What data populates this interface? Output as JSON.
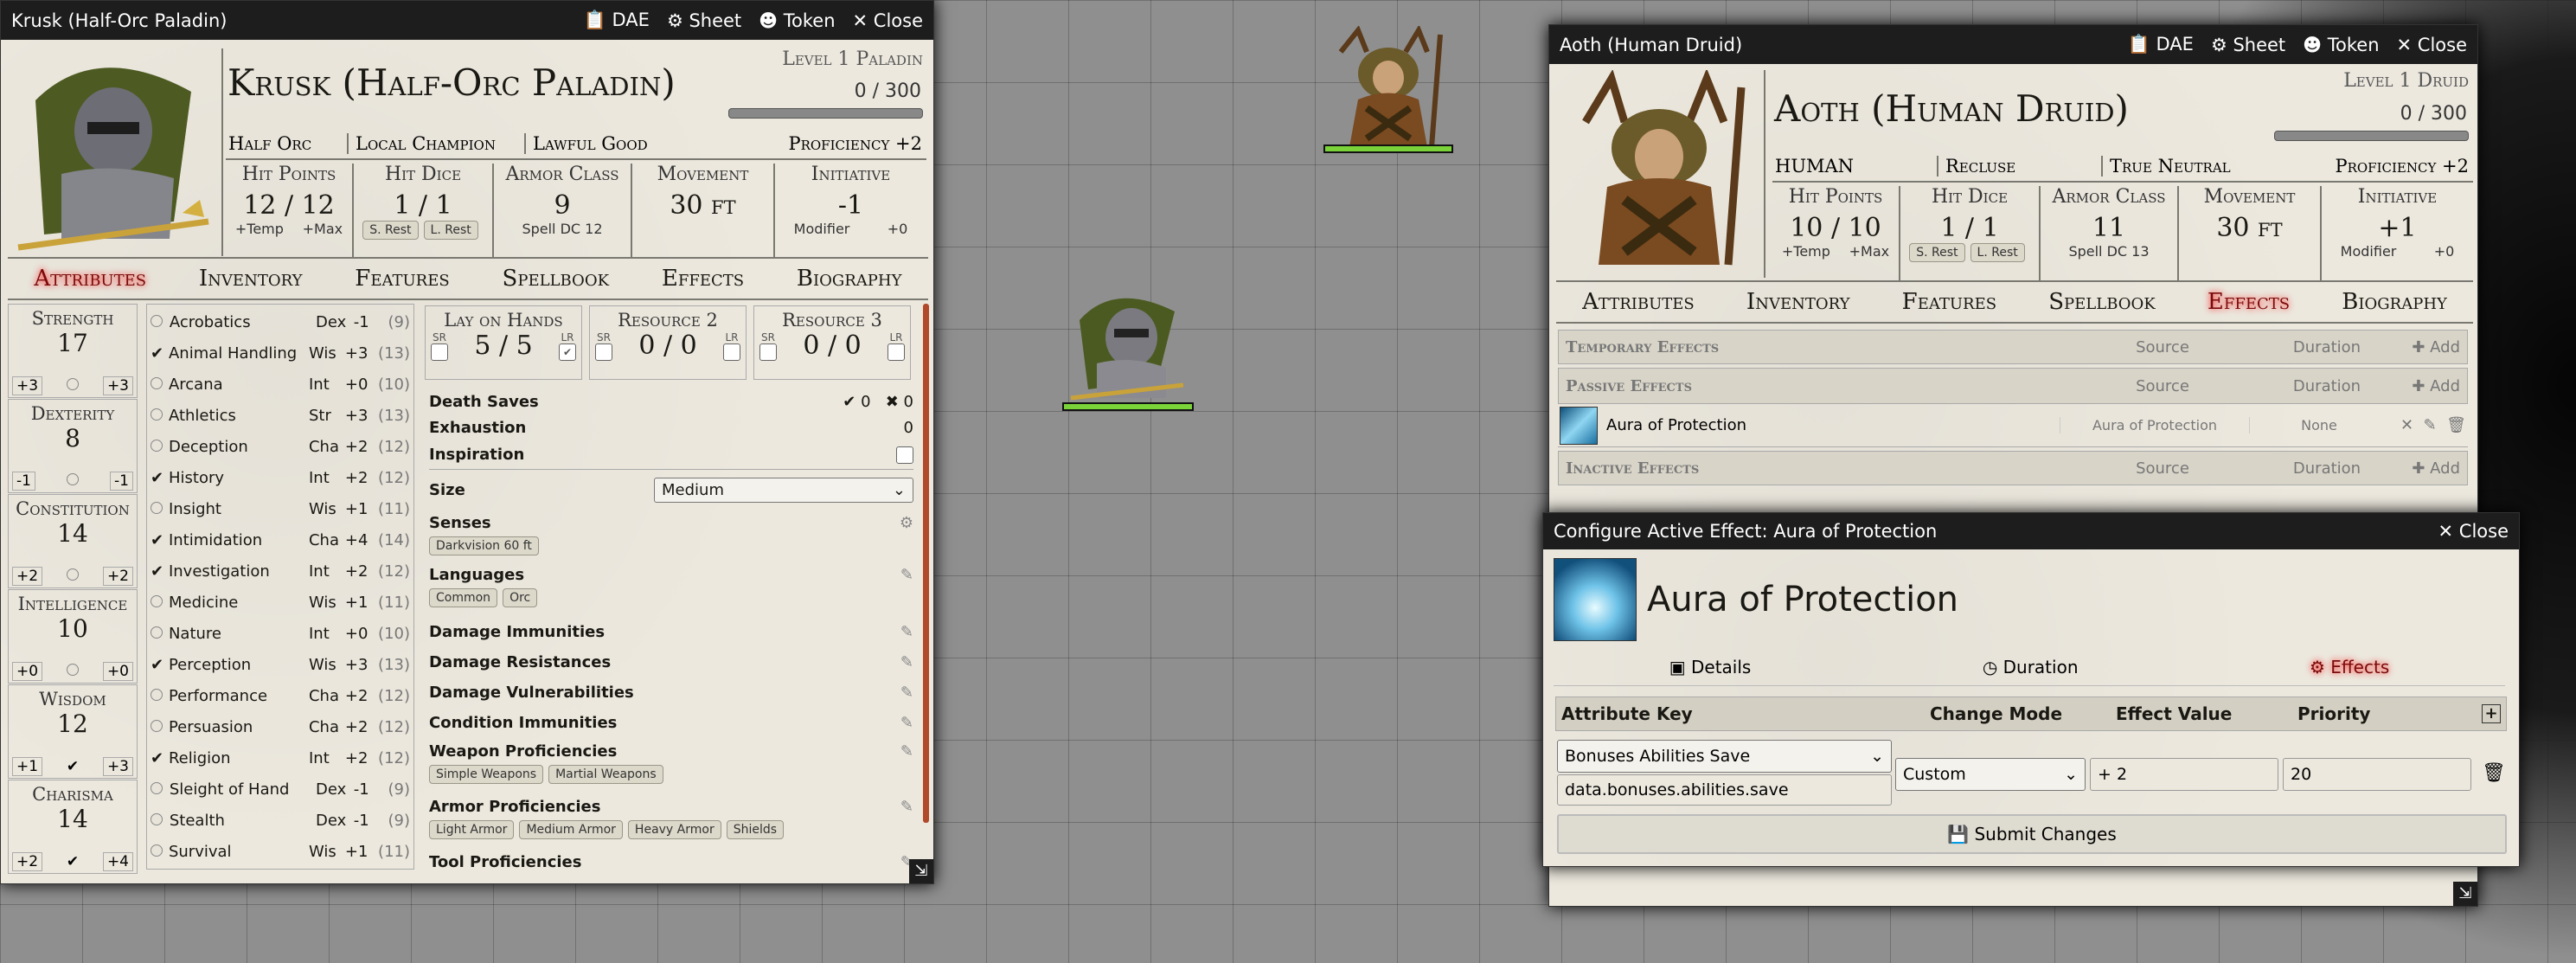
{
  "colors": {
    "hp_bar": "#7bd33a",
    "accent": "#7a0a0a",
    "scrollbar": "#b14a2a",
    "titlebar": "#1d1d1d"
  },
  "tokens": [
    {
      "name": "druid-token"
    },
    {
      "name": "paladin-token"
    }
  ],
  "left": {
    "title": "Krusk (Half-Orc Paladin)",
    "header_buttons": {
      "dae": "DAE",
      "sheet": "Sheet",
      "token": "Token",
      "close": "Close"
    },
    "name": "Krusk (Half-Orc Paladin)",
    "level": "Level 1 Paladin",
    "xp": "0 / 300",
    "race": "Half Orc",
    "background": "Local Champion",
    "alignment": "Lawful Good",
    "proficiency": "Proficiency +2",
    "hp": {
      "label": "Hit Points",
      "value": "12",
      "max": "12",
      "temp": "+Temp",
      "maxlbl": "+Max"
    },
    "hd": {
      "label": "Hit Dice",
      "value": "1 / 1",
      "short": "S. Rest",
      "long": "L. Rest"
    },
    "ac": {
      "label": "Armor Class",
      "value": "9",
      "sub": "Spell DC 12"
    },
    "move": {
      "label": "Movement",
      "value": "30 ft"
    },
    "init": {
      "label": "Initiative",
      "value": "-1",
      "mod": "Modifier",
      "bonus": "+0"
    },
    "tabs": [
      "Attributes",
      "Inventory",
      "Features",
      "Spellbook",
      "Effects",
      "Biography"
    ],
    "abilities": [
      {
        "name": "Strength",
        "score": "17",
        "mod": "+3",
        "save": "+3",
        "prof": false
      },
      {
        "name": "Dexterity",
        "score": "8",
        "mod": "-1",
        "save": "-1",
        "prof": false
      },
      {
        "name": "Constitution",
        "score": "14",
        "mod": "+2",
        "save": "+2",
        "prof": false
      },
      {
        "name": "Intelligence",
        "score": "10",
        "mod": "+0",
        "save": "+0",
        "prof": false
      },
      {
        "name": "Wisdom",
        "score": "12",
        "mod": "+1",
        "save": "+3",
        "prof": true
      },
      {
        "name": "Charisma",
        "score": "14",
        "mod": "+2",
        "save": "+4",
        "prof": true
      }
    ],
    "skills": [
      {
        "name": "Acrobatics",
        "abil": "Dex",
        "mod": "-1",
        "pass": "(9)",
        "prof": false
      },
      {
        "name": "Animal Handling",
        "abil": "Wis",
        "mod": "+3",
        "pass": "(13)",
        "prof": true
      },
      {
        "name": "Arcana",
        "abil": "Int",
        "mod": "+0",
        "pass": "(10)",
        "prof": false
      },
      {
        "name": "Athletics",
        "abil": "Str",
        "mod": "+3",
        "pass": "(13)",
        "prof": false
      },
      {
        "name": "Deception",
        "abil": "Cha",
        "mod": "+2",
        "pass": "(12)",
        "prof": false
      },
      {
        "name": "History",
        "abil": "Int",
        "mod": "+2",
        "pass": "(12)",
        "prof": true
      },
      {
        "name": "Insight",
        "abil": "Wis",
        "mod": "+1",
        "pass": "(11)",
        "prof": false
      },
      {
        "name": "Intimidation",
        "abil": "Cha",
        "mod": "+4",
        "pass": "(14)",
        "prof": true
      },
      {
        "name": "Investigation",
        "abil": "Int",
        "mod": "+2",
        "pass": "(12)",
        "prof": true
      },
      {
        "name": "Medicine",
        "abil": "Wis",
        "mod": "+1",
        "pass": "(11)",
        "prof": false
      },
      {
        "name": "Nature",
        "abil": "Int",
        "mod": "+0",
        "pass": "(10)",
        "prof": false
      },
      {
        "name": "Perception",
        "abil": "Wis",
        "mod": "+3",
        "pass": "(13)",
        "prof": true
      },
      {
        "name": "Performance",
        "abil": "Cha",
        "mod": "+2",
        "pass": "(12)",
        "prof": false
      },
      {
        "name": "Persuasion",
        "abil": "Cha",
        "mod": "+2",
        "pass": "(12)",
        "prof": false
      },
      {
        "name": "Religion",
        "abil": "Int",
        "mod": "+2",
        "pass": "(12)",
        "prof": true
      },
      {
        "name": "Sleight of Hand",
        "abil": "Dex",
        "mod": "-1",
        "pass": "(9)",
        "prof": false
      },
      {
        "name": "Stealth",
        "abil": "Dex",
        "mod": "-1",
        "pass": "(9)",
        "prof": false
      },
      {
        "name": "Survival",
        "abil": "Wis",
        "mod": "+1",
        "pass": "(11)",
        "prof": false
      }
    ],
    "resources": [
      {
        "name": "Lay on Hands",
        "value": "5",
        "max": "5",
        "sr": false,
        "lr": true
      },
      {
        "name": "Resource 2",
        "value": "0",
        "max": "0",
        "sr": false,
        "lr": false
      },
      {
        "name": "Resource 3",
        "value": "0",
        "max": "0",
        "sr": false,
        "lr": false
      }
    ],
    "sr_label": "SR",
    "lr_label": "LR",
    "death_saves": "Death Saves",
    "death_succ": "0",
    "death_fail": "0",
    "exhaustion": "Exhaustion",
    "exhaustion_val": "0",
    "inspiration": "Inspiration",
    "size_label": "Size",
    "size_value": "Medium",
    "senses": "Senses",
    "senses_chips": [
      "Darkvision 60 ft"
    ],
    "languages": "Languages",
    "language_chips": [
      "Common",
      "Orc"
    ],
    "traits": [
      "Damage Immunities",
      "Damage Resistances",
      "Damage Vulnerabilities",
      "Condition Immunities"
    ],
    "weapon_prof": "Weapon Proficiencies",
    "weapon_chips": [
      "Simple Weapons",
      "Martial Weapons"
    ],
    "armor_prof": "Armor Proficiencies",
    "armor_chips": [
      "Light Armor",
      "Medium Armor",
      "Heavy Armor",
      "Shields"
    ],
    "tool_prof": "Tool Proficiencies"
  },
  "right": {
    "title": "Aoth (Human Druid)",
    "header_buttons": {
      "dae": "DAE",
      "sheet": "Sheet",
      "token": "Token",
      "close": "Close"
    },
    "name": "Aoth (Human Druid)",
    "level": "Level 1 Druid",
    "xp": "0 / 300",
    "race": "HUMAN",
    "background": "Recluse",
    "alignment": "True Neutral",
    "proficiency": "Proficiency +2",
    "hp": {
      "label": "Hit Points",
      "value": "10",
      "max": "10",
      "temp": "+Temp",
      "maxlbl": "+Max"
    },
    "hd": {
      "label": "Hit Dice",
      "value": "1 / 1",
      "short": "S. Rest",
      "long": "L. Rest"
    },
    "ac": {
      "label": "Armor Class",
      "value": "11",
      "sub": "Spell DC 13"
    },
    "move": {
      "label": "Movement",
      "value": "30 ft"
    },
    "init": {
      "label": "Initiative",
      "value": "+1",
      "mod": "Modifier",
      "bonus": "+0"
    },
    "tabs": [
      "Attributes",
      "Inventory",
      "Features",
      "Spellbook",
      "Effects",
      "Biography"
    ],
    "effect_sections": [
      {
        "name": "Temporary Effects",
        "source": "Source",
        "duration": "Duration",
        "add": "Add"
      },
      {
        "name": "Passive Effects",
        "source": "Source",
        "duration": "Duration",
        "add": "Add"
      }
    ],
    "effect_row": {
      "name": "Aura of Protection",
      "source": "Aura of Protection",
      "duration": "None"
    },
    "inactive": {
      "name": "Inactive Effects",
      "source": "Source",
      "duration": "Duration",
      "add": "Add"
    }
  },
  "config": {
    "title": "Configure Active Effect: Aura of Protection",
    "close": "Close",
    "name": "Aura of Protection",
    "tabs": [
      "Details",
      "Duration",
      "Effects"
    ],
    "cols": [
      "Attribute Key",
      "Change Mode",
      "Effect Value",
      "Priority"
    ],
    "key_select": "Bonuses Abilities Save",
    "key_value": "data.bonuses.abilities.save",
    "mode": "Custom",
    "value": "+ 2",
    "priority": "20",
    "submit": "Submit Changes"
  }
}
